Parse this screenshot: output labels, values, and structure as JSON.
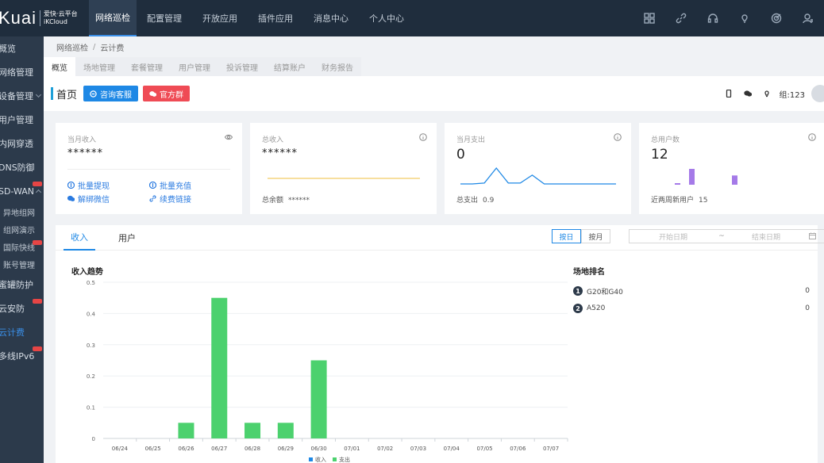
{
  "logo": {
    "word": "Kuai",
    "name": "爱快·云平台",
    "sub": "iKCloud"
  },
  "topnav": [
    "网络巡检",
    "配置管理",
    "开放应用",
    "插件应用",
    "消息中心",
    "个人中心"
  ],
  "topnav_active": "网络巡检",
  "top_icons": [
    "grid-icon",
    "link-icon",
    "headset-icon",
    "bulb-icon",
    "target-icon",
    "user-icon"
  ],
  "sidebar": {
    "items": [
      {
        "label": "概览",
        "type": "item"
      },
      {
        "label": "网络管理",
        "type": "item"
      },
      {
        "label": "设备管理",
        "type": "item",
        "arrow": "down"
      },
      {
        "label": "用户管理",
        "type": "item"
      },
      {
        "label": "内网穿透",
        "type": "item"
      },
      {
        "label": "DNS防御",
        "type": "item"
      },
      {
        "label": "SD-WAN",
        "type": "item",
        "arrow": "up",
        "badge": true
      },
      {
        "label": "异地组网",
        "type": "sub"
      },
      {
        "label": "组网演示",
        "type": "sub"
      },
      {
        "label": "国际快线",
        "type": "sub",
        "badge": true
      },
      {
        "label": "账号管理",
        "type": "sub"
      },
      {
        "label": "蜜罐防护",
        "type": "item"
      },
      {
        "label": "云安防",
        "type": "item",
        "badge": true
      },
      {
        "label": "云计费",
        "type": "item",
        "active": true
      },
      {
        "label": "多线IPv6",
        "type": "item",
        "badge": true
      }
    ]
  },
  "breadcrumb": {
    "parent": "网络巡检",
    "separator": "/",
    "current": "云计费"
  },
  "tabs": [
    "概览",
    "场地管理",
    "套餐管理",
    "用户管理",
    "投诉管理",
    "结算账户",
    "财务报告"
  ],
  "tab_active": "概览",
  "header": {
    "title": "首页",
    "btn_consult": "咨询客服",
    "btn_group": "官方群",
    "user": "组:123"
  },
  "cards": {
    "month_income": {
      "title": "当月收入",
      "value": "******",
      "links": [
        "批量提现",
        "批量充值",
        "解绑微信",
        "续费链接"
      ]
    },
    "total_income": {
      "title": "总收入",
      "value": "******",
      "foot_label": "总余额",
      "foot_value": "******"
    },
    "month_expense": {
      "title": "当月支出",
      "value": "0",
      "foot_label": "总支出",
      "foot_value": "0.9"
    },
    "total_users": {
      "title": "总用户数",
      "value": "12",
      "foot_label": "近两周新用户",
      "foot_value": "15"
    }
  },
  "panel": {
    "tabs": [
      "收入",
      "用户"
    ],
    "tab_active": "收入",
    "seg": [
      "按日",
      "按月"
    ],
    "seg_active": "按日",
    "date_start_placeholder": "开始日期",
    "date_tilde": "~",
    "date_end_placeholder": "结束日期",
    "chart_title": "收入趋势",
    "ranking_title": "场地排名",
    "ranking": [
      {
        "rank": "1",
        "name": "G20和G40",
        "value": "0"
      },
      {
        "rank": "2",
        "name": "A520",
        "value": "0"
      }
    ]
  },
  "colors": {
    "income": "#1e88e5",
    "expense": "#4cd16e",
    "accent": "#1e88e5",
    "topbar": "#1f2d3d"
  },
  "chart_data": {
    "type": "bar",
    "title": "收入趋势",
    "categories": [
      "06/24",
      "06/25",
      "06/26",
      "06/27",
      "06/28",
      "06/29",
      "06/30",
      "07/01",
      "07/02",
      "07/03",
      "07/04",
      "07/05",
      "07/06",
      "07/07"
    ],
    "series": [
      {
        "name": "收入",
        "values": [
          0,
          0,
          0,
          0,
          0,
          0,
          0,
          0,
          0,
          0,
          0,
          0,
          0,
          0
        ]
      },
      {
        "name": "支出",
        "values": [
          0,
          0,
          0.05,
          0.45,
          0.05,
          0.05,
          0.25,
          0,
          0,
          0,
          0,
          0,
          0,
          0
        ]
      }
    ],
    "yticks": [
      "0",
      "0.1",
      "0.2",
      "0.3",
      "0.4",
      "0.5"
    ],
    "ylim": [
      0,
      0.5
    ],
    "legend": "bottom-center",
    "grid": true
  },
  "expense_sparkline": {
    "values": [
      0,
      0,
      0.05,
      0.9,
      0.05,
      0.05,
      0.5,
      0,
      0,
      0,
      0,
      0,
      0,
      0
    ]
  },
  "users_sparkbars": {
    "values": [
      1,
      0,
      12,
      0,
      0,
      0,
      0,
      0,
      7,
      0
    ]
  }
}
